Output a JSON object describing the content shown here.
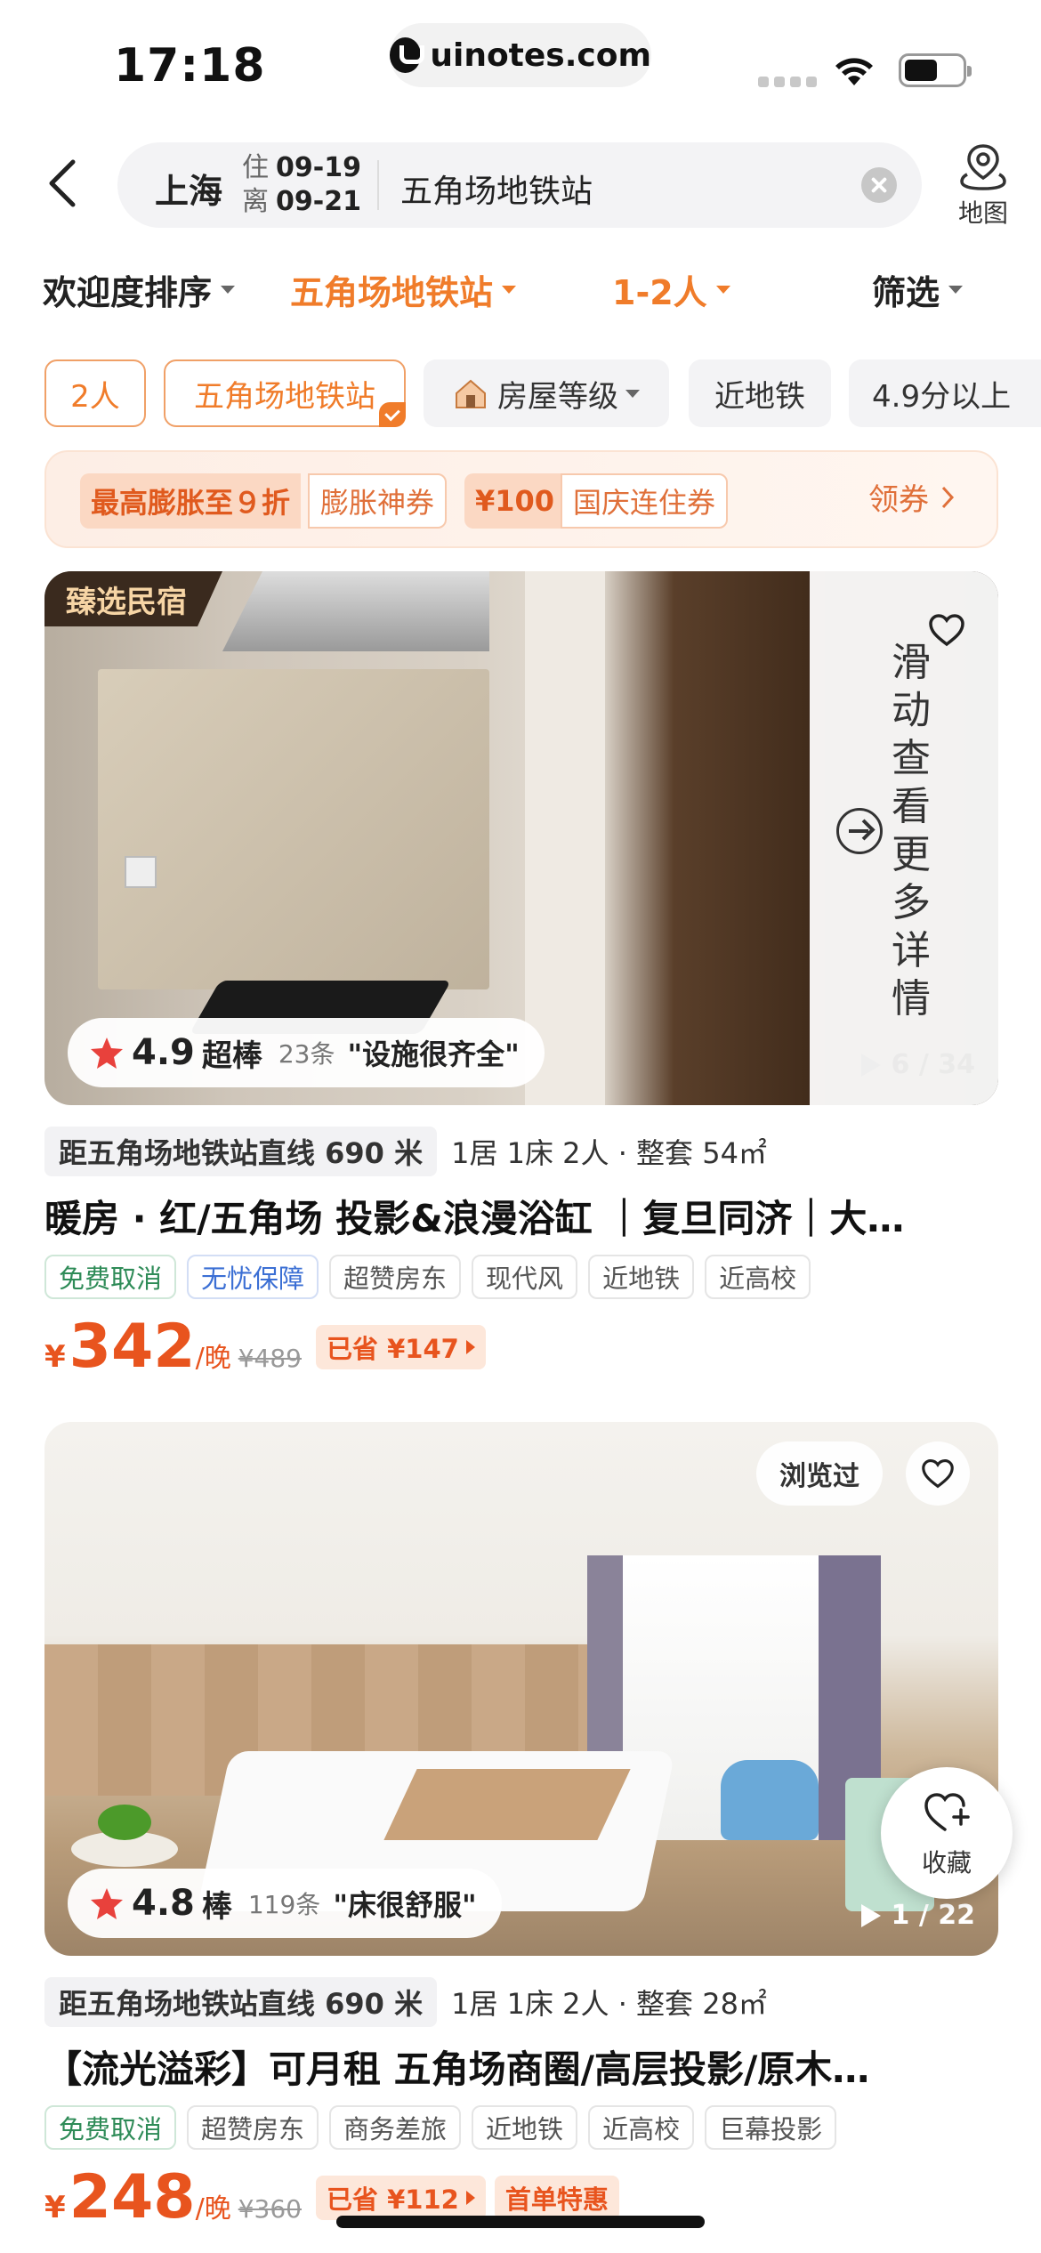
{
  "status_bar": {
    "time": "17:18",
    "url": "uinotes.com"
  },
  "search": {
    "city": "上海",
    "checkin_label": "住",
    "checkin_date": "09-19",
    "checkout_label": "离",
    "checkout_date": "09-21",
    "keyword": "五角场地铁站",
    "map_label": "地图"
  },
  "sort": {
    "popularity": "欢迎度排序",
    "location": "五角场地铁站",
    "guests": "1-2人",
    "filter": "筛选"
  },
  "chips": [
    "2人",
    "五角场地铁站",
    "房屋等级",
    "近地铁",
    "4.9分以上"
  ],
  "coupon": {
    "tag1": "最高膨胀至９折",
    "tag1_name": "膨胀神券",
    "tag2": "¥100",
    "tag2_name": "国庆连住券",
    "get": "领券"
  },
  "listings": [
    {
      "badge": "臻选民宿",
      "more_text": "滑动查看更多详情",
      "photo_counter": "6 / 34",
      "rating": "4.9",
      "rating_word": "超棒",
      "review_count": "23条",
      "review_quote": "\"设施很齐全\"",
      "distance": "距五角场地铁站直线 690 米",
      "room_info": "1居 1床 2人 · 整套 54㎡",
      "title": "暖房 · 红/五角场 投影&浪漫浴缸 ｜复旦同济｜大…",
      "tags": [
        "免费取消",
        "无忧保障",
        "超赞房东",
        "现代风",
        "近地铁",
        "近高校"
      ],
      "currency": "¥",
      "price": "342",
      "per_night": "/晚",
      "original_price": "¥489",
      "saved": "已省 ¥147"
    },
    {
      "viewed": "浏览过",
      "photo_counter": "1 / 22",
      "rating": "4.8",
      "rating_word": "棒",
      "review_count": "119条",
      "review_quote": "\"床很舒服\"",
      "distance": "距五角场地铁站直线 690 米",
      "room_info": "1居 1床 2人 · 整套 28㎡",
      "title": "【流光溢彩】可月租 五角场商圈/高层投影/原木…",
      "tags": [
        "免费取消",
        "超赞房东",
        "商务差旅",
        "近地铁",
        "近高校",
        "巨幕投影"
      ],
      "currency": "¥",
      "price": "248",
      "per_night": "/晚",
      "original_price": "¥360",
      "saved": "已省 ¥112",
      "first_deal": "首单特惠",
      "collect_label": "收藏"
    }
  ],
  "colors": {
    "accent": "#f07c2a",
    "price": "#e8541e",
    "badge_dark": "#3a2a1e"
  }
}
